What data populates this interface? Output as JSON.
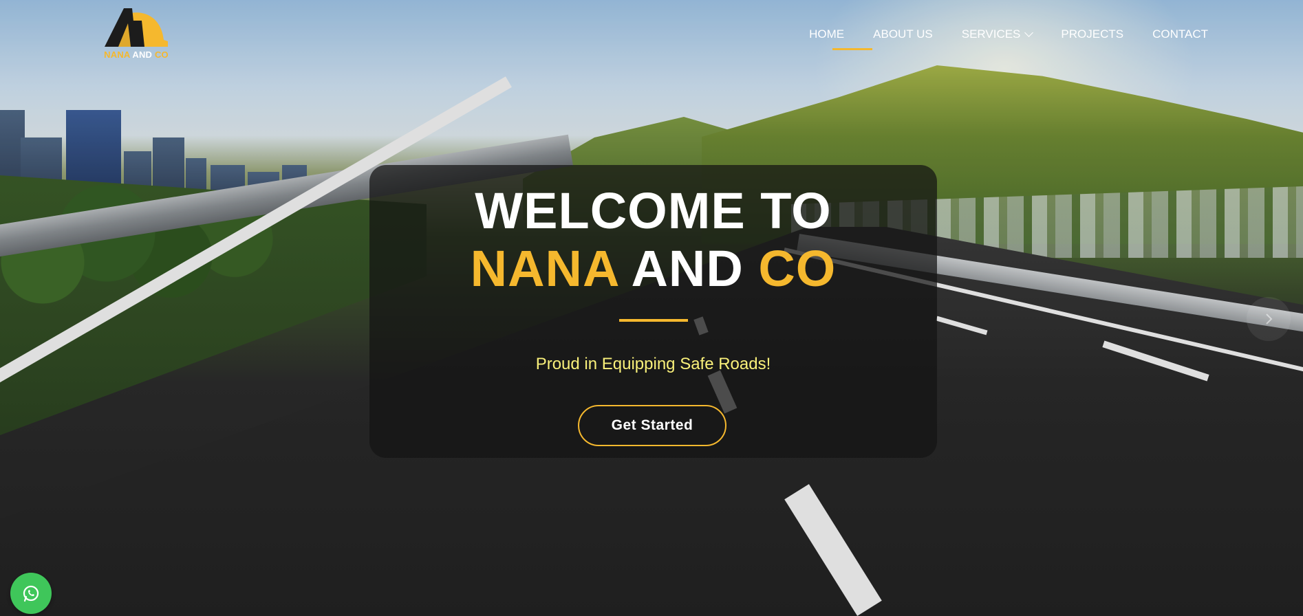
{
  "brand": {
    "name_part1": "NANA",
    "name_part2": "AND",
    "name_part3": "CO",
    "accent_color": "#f5b82e"
  },
  "nav": {
    "items": [
      {
        "label": "Home",
        "active": true
      },
      {
        "label": "About Us"
      },
      {
        "label": "Services"
      },
      {
        "label": "Projects"
      },
      {
        "label": "Contact"
      }
    ]
  },
  "hero": {
    "title_line1": "WELCOME TO",
    "title_word1": "NANA",
    "title_word2": "AND",
    "title_word3": "CO",
    "subtitle": "Proud in Equipping Safe Roads!",
    "cta_label": "Get Started"
  },
  "floating": {
    "whatsapp_icon": "whatsapp-icon",
    "whatsapp_color": "#3fc65a",
    "next_icon": "chevron-right-icon"
  }
}
